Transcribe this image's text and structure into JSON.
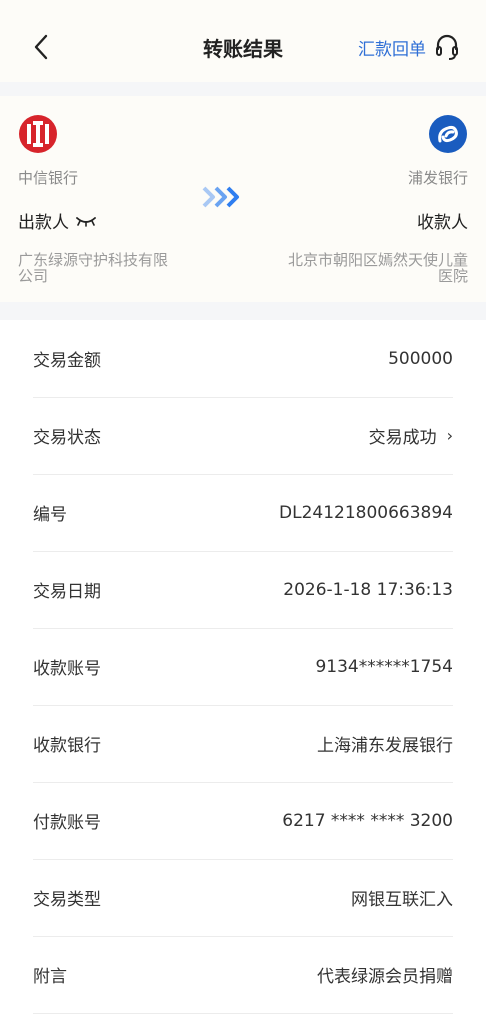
{
  "nav": {
    "title": "转账结果",
    "remit_link": "汇款回单"
  },
  "transfer": {
    "payer_bank": "中信银行",
    "payee_bank": "浦发银行",
    "payer_role": "出款人",
    "payee_role": "收款人",
    "payer_name_line1": "广东绿源守护科技有限",
    "payer_name_line2": "公司",
    "payee_name_line1": "北京市朝阳区嫣然天使儿童",
    "payee_name_line2": "医院",
    "colors": {
      "arrow_light": "#a9c8f4",
      "arrow_dark": "#2f7ef0",
      "citic_red": "#d7242b",
      "spdb_blue": "#1a5cbf"
    }
  },
  "details": [
    {
      "label": "交易金额",
      "value": "500000"
    },
    {
      "label": "交易状态",
      "value": "交易成功",
      "chevron": "›"
    },
    {
      "label": "编号",
      "value": "DL24121800663894"
    },
    {
      "label": "交易日期",
      "value": "2026-1-18 17:36:13"
    },
    {
      "label": "收款账号",
      "value": "9134******1754"
    },
    {
      "label": "收款银行",
      "value": "上海浦东发展银行"
    },
    {
      "label": "付款账号",
      "value": "6217 **** **** 3200"
    },
    {
      "label": "交易类型",
      "value": "网银互联汇入"
    },
    {
      "label": "附言",
      "value": "代表绿源会员捐赠"
    }
  ]
}
